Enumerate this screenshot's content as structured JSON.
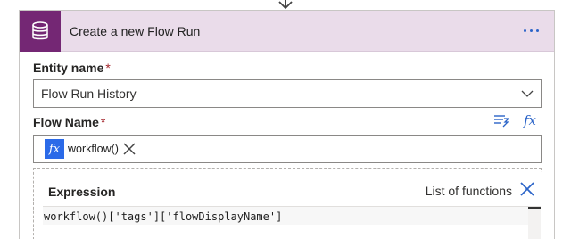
{
  "card": {
    "title": "Create a new Flow Run",
    "icon": "database-icon",
    "accent_color": "#742774",
    "header_bg": "#eadcea"
  },
  "fields": {
    "entity_name": {
      "label": "Entity name",
      "required_mark": "*",
      "value": "Flow Run History"
    },
    "flow_name": {
      "label": "Flow Name",
      "required_mark": "*",
      "token": {
        "icon_text": "fx",
        "text": "workflow()"
      }
    }
  },
  "expression_panel": {
    "title": "Expression",
    "list_functions_label": "List of functions",
    "code": "workflow()['tags']['flowDisplayName']"
  },
  "icons": {
    "more": "more-options-icon",
    "chevron": "chevron-down-icon",
    "dynamic_content": "dynamic-content-icon",
    "fx": "fx",
    "close": "close-icon"
  }
}
